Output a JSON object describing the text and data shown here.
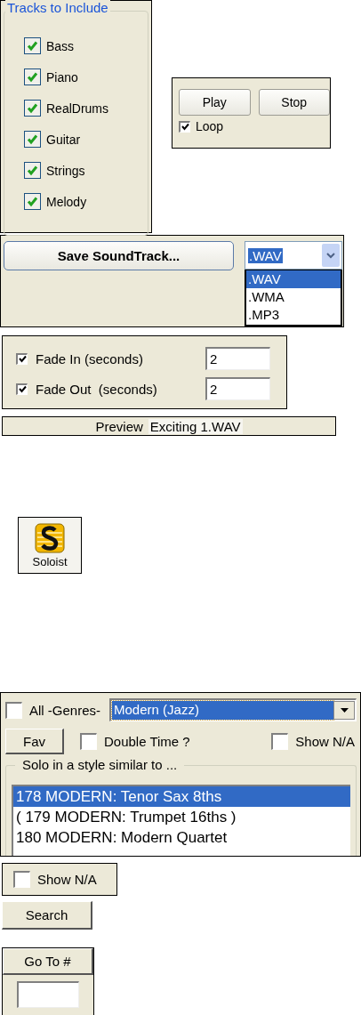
{
  "tracks": {
    "title": "Tracks to Include",
    "items": [
      {
        "label": "Bass",
        "checked": true
      },
      {
        "label": "Piano",
        "checked": true
      },
      {
        "label": "RealDrums",
        "checked": true
      },
      {
        "label": "Guitar",
        "checked": true
      },
      {
        "label": "Strings",
        "checked": true
      },
      {
        "label": "Melody",
        "checked": true
      }
    ]
  },
  "playback": {
    "buttons": [
      "Play",
      "Stop"
    ],
    "loop": {
      "label": "Loop",
      "checked": true
    }
  },
  "save": {
    "button": "Save SoundTrack...",
    "format": {
      "value": ".WAV",
      "options": [
        {
          "label": ".WAV",
          "selected": true
        },
        {
          "label": ".WMA",
          "selected": false
        },
        {
          "label": ".MP3",
          "selected": false
        }
      ]
    }
  },
  "fade": [
    {
      "label": "Fade In (seconds)",
      "checked": true,
      "value": "2"
    },
    {
      "label": "Fade Out  (seconds)",
      "checked": true,
      "value": "2"
    }
  ],
  "preview": {
    "label": "Preview",
    "file": "Exciting 1.WAV"
  },
  "soloist_button": {
    "label": "Soloist"
  },
  "genres": {
    "all_genres": {
      "label": "All -Genres-",
      "checked": false
    },
    "genre": "Modern (Jazz)",
    "fav_button": "Fav",
    "double_time": {
      "label": "Double Time ?",
      "checked": false
    },
    "show_na": {
      "label": "Show N/A",
      "checked": false
    },
    "list_title": "Solo in a style similar to ...",
    "styles": [
      {
        "label": "178 MODERN: Tenor Sax 8ths",
        "selected": true
      },
      {
        "label": "( 179 MODERN: Trumpet 16ths )",
        "selected": false
      },
      {
        "label": "180 MODERN: Modern Quartet",
        "selected": false
      }
    ]
  },
  "show_na": {
    "label": "Show N/A",
    "checked": false
  },
  "search_button": "Search",
  "goto": {
    "button": "Go To #"
  }
}
